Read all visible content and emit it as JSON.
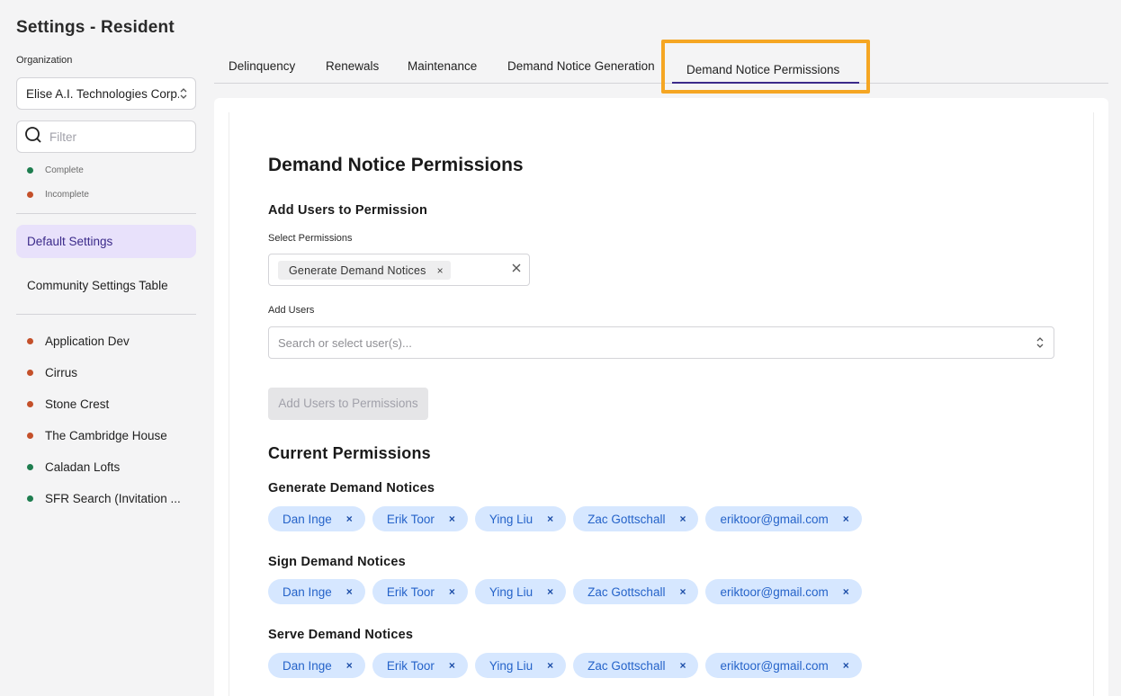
{
  "app": {
    "title": "Settings - Resident"
  },
  "sidebar": {
    "org_label": "Organization",
    "org_value": "Elise A.I. Technologies Corp.",
    "filter_placeholder": "Filter",
    "legend": {
      "complete": "Complete",
      "incomplete": "Incomplete"
    },
    "nav": [
      {
        "label": "Default Settings",
        "active": true
      },
      {
        "label": "Community Settings Table",
        "active": false
      }
    ],
    "communities": [
      {
        "label": "Application Dev",
        "status": "incomplete"
      },
      {
        "label": "Cirrus",
        "status": "incomplete"
      },
      {
        "label": "Stone Crest",
        "status": "incomplete"
      },
      {
        "label": "The Cambridge House",
        "status": "incomplete"
      },
      {
        "label": "Caladan Lofts",
        "status": "complete"
      },
      {
        "label": "SFR Search (Invitation ...",
        "status": "complete"
      }
    ]
  },
  "tabs": [
    {
      "label": "Delinquency"
    },
    {
      "label": "Renewals"
    },
    {
      "label": "Maintenance"
    },
    {
      "label": "Demand Notice Generation"
    },
    {
      "label": "Demand Notice Permissions",
      "active": true
    }
  ],
  "main": {
    "title": "Demand Notice Permissions",
    "add_section": {
      "heading": "Add Users to Permission",
      "select_permissions_label": "Select Permissions",
      "selected_permission": "Generate Demand Notices",
      "add_users_label": "Add Users",
      "add_users_placeholder": "Search or select user(s)...",
      "submit_label": "Add Users to Permissions"
    },
    "current_heading": "Current Permissions",
    "permissions": [
      {
        "name": "Generate Demand Notices",
        "users": [
          "Dan Inge",
          "Erik Toor",
          "Ying Liu",
          "Zac Gottschall",
          "eriktoor@gmail.com"
        ]
      },
      {
        "name": "Sign Demand Notices",
        "users": [
          "Dan Inge",
          "Erik Toor",
          "Ying Liu",
          "Zac Gottschall",
          "eriktoor@gmail.com"
        ]
      },
      {
        "name": "Serve Demand Notices",
        "users": [
          "Dan Inge",
          "Erik Toor",
          "Ying Liu",
          "Zac Gottschall",
          "eriktoor@gmail.com"
        ]
      }
    ],
    "remove_glyph": "×"
  },
  "colors": {
    "complete": "#1e7d4f",
    "incomplete": "#c4502a",
    "highlight": "#f5a623",
    "active_nav_bg": "#e8e1fb",
    "chip_bg": "#d6e7ff"
  }
}
